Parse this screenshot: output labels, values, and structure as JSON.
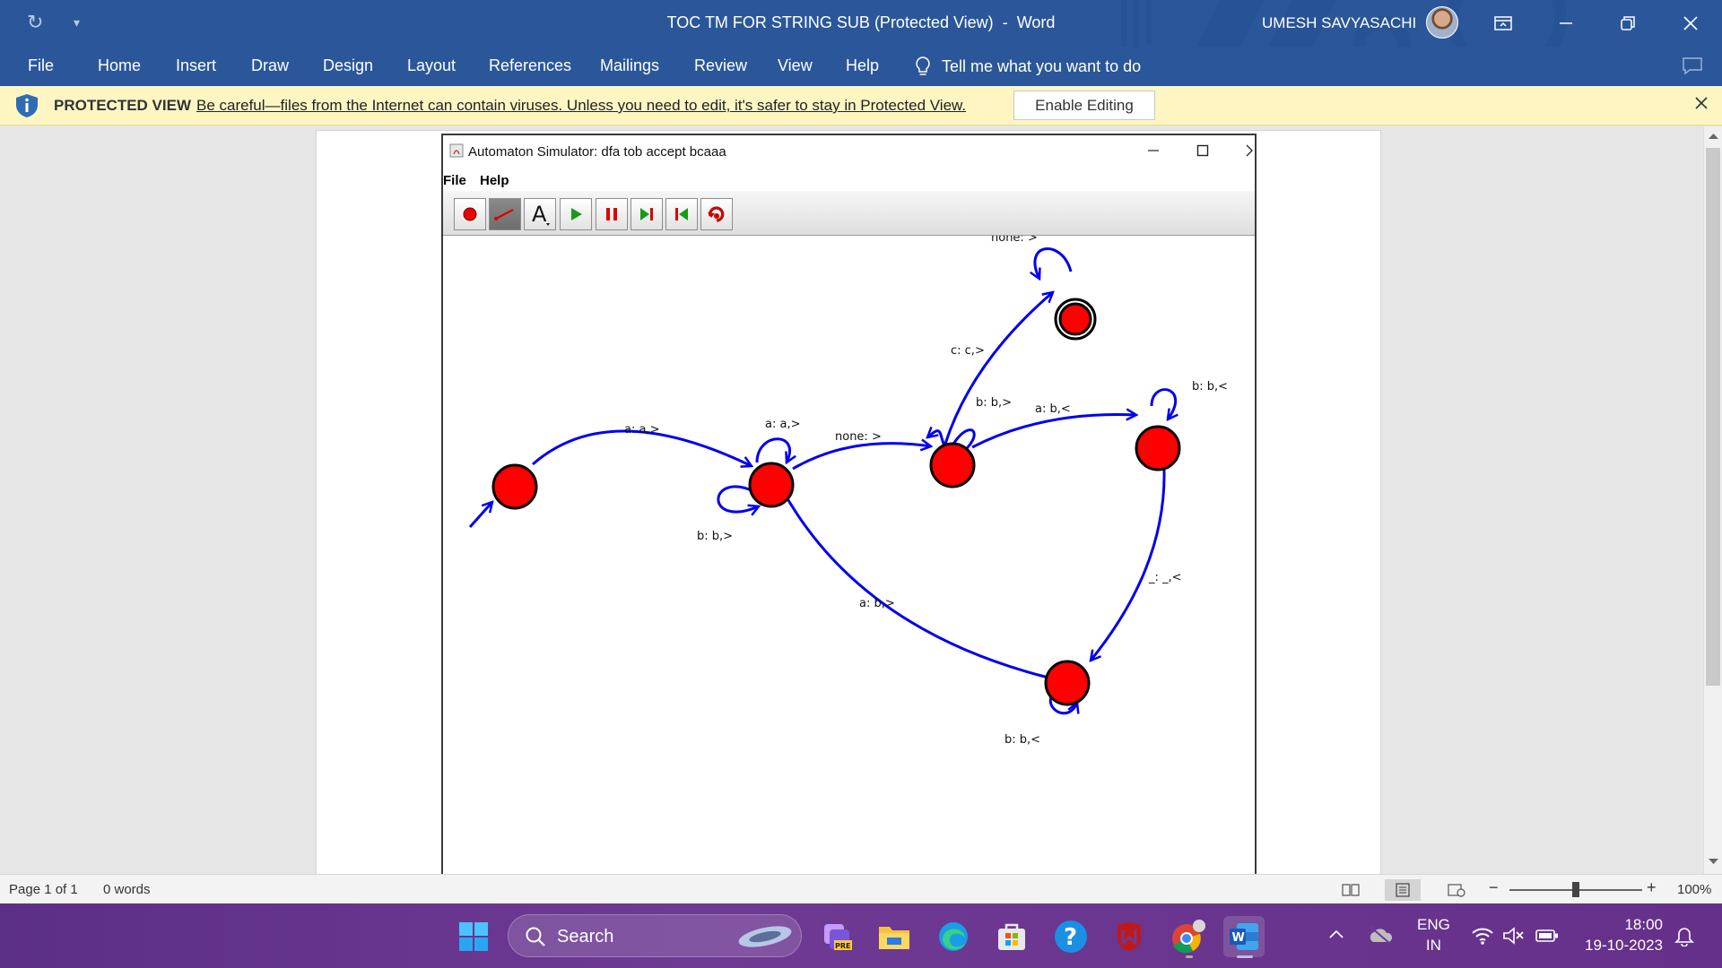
{
  "title_bar": {
    "doc_title": "TOC TM FOR STRING SUB (Protected View)",
    "separator": "-",
    "app_name": "Word",
    "user_name": "UMESH SAVYASACHI"
  },
  "ribbon": {
    "tabs": [
      "File",
      "Home",
      "Insert",
      "Draw",
      "Design",
      "Layout",
      "References",
      "Mailings",
      "Review",
      "View",
      "Help"
    ],
    "tell_me": "Tell me what you want to do"
  },
  "protected_view": {
    "title": "PROTECTED VIEW",
    "message": "Be careful—files from the Internet can contain viruses. Unless you need to edit, it's safer to stay in Protected View.",
    "enable_button": "Enable Editing"
  },
  "simulator": {
    "window_title": "Automaton Simulator: dfa tob accept bcaaa",
    "menu": [
      "File",
      "Help"
    ],
    "toolbar": [
      "add-state",
      "add-transition",
      "add-label",
      "run",
      "pause",
      "step",
      "reset",
      "undo"
    ],
    "transition_labels": {
      "q0_q1": "a: a,>",
      "q1_loop_a": "a: a,>",
      "q1_loop_b": "b: b,>",
      "q1_q2": "none: >",
      "q2_loop": "b: b,>",
      "q2_accept": "c: c,>",
      "accept_loop": "none: >",
      "q2_q3": "a: b,<",
      "q3_loop": "b: b,<",
      "q3_q4": "_: _,<",
      "q4_loop": "b: b,<",
      "q4_q1": "a: b,>"
    },
    "colors": {
      "state_fill": "#ff0000",
      "edge": "#0000ee"
    }
  },
  "status_bar": {
    "page": "Page 1 of 1",
    "words": "0 words",
    "zoom": "100%"
  },
  "taskbar": {
    "search": "Search",
    "lang_top": "ENG",
    "lang_bottom": "IN",
    "time": "18:00",
    "date": "19-10-2023"
  }
}
